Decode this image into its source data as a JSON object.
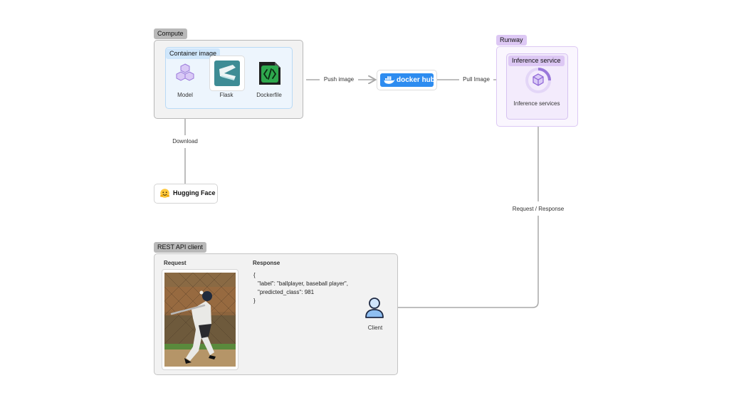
{
  "compute": {
    "title": "Compute",
    "container_title": "Container image",
    "items": [
      {
        "label": "Model",
        "icon": "cubes-icon"
      },
      {
        "label": "Flask",
        "icon": "flask-icon"
      },
      {
        "label": "Dockerfile",
        "icon": "dockerfile-icon"
      }
    ]
  },
  "arrows": {
    "push": "Push image",
    "pull": "Pull Image",
    "download": "Download",
    "request_response": "Request / Response"
  },
  "dockerhub": {
    "label": "docker hub",
    "color": "#2d8cf0"
  },
  "runway": {
    "title": "Runway",
    "service_title": "Inference service",
    "service_label": "Inference services"
  },
  "huggingface": {
    "label": "Hugging Face"
  },
  "rest": {
    "title": "REST API client",
    "request_label": "Request",
    "response_label": "Response",
    "response_lines": [
      "{",
      "\"label\": \"ballplayer, baseball player\",",
      "\"predicted_class\": 981",
      "}"
    ],
    "client_label": "Client"
  },
  "colors": {
    "accent_purple": "#8d63d6",
    "panel_gray": "#f2f2f2",
    "arrow": "#a8a8a8"
  }
}
